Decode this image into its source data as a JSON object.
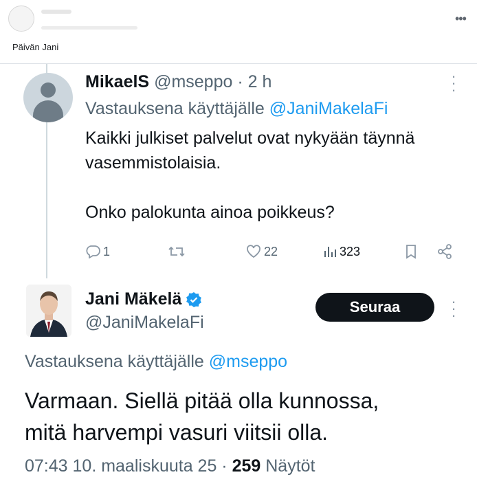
{
  "facebook": {
    "caption": "Päivän Jani",
    "more_icon": "more-horizontal-icon"
  },
  "reply_tweet": {
    "name": "MikaelS",
    "handle": "@mseppo",
    "separator": " · ",
    "time": "2 h",
    "replying_prefix": "Vastauksena käyttäjälle ",
    "replying_to": "@JaniMakelaFi",
    "text_lines": [
      "Kaikki julkiset palvelut ovat nykyään täynnä vasemmistolaisia.",
      "Onko palokunta ainoa poikkeus?"
    ],
    "actions": {
      "reply_count": "1",
      "retweet_count": "",
      "like_count": "22",
      "views_count": "323"
    }
  },
  "main_tweet": {
    "name": "Jani Mäkelä",
    "verified": true,
    "handle": "@JaniMakelaFi",
    "follow_label": "Seuraa",
    "replying_prefix": "Vastauksena käyttäjälle ",
    "replying_to": "@mseppo",
    "text_lines": [
      "Varmaan. Siellä pitää olla kunnossa,",
      "mitä harvempi vasuri viitsii olla."
    ],
    "timestamp": "07:43 10. maaliskuuta 25",
    "separator": " · ",
    "views_count": "259",
    "views_label": " Näytöt"
  },
  "colors": {
    "accent": "#1d9bf0",
    "text_primary": "#0f1419",
    "text_secondary": "#536471",
    "button_bg": "#0f1419"
  }
}
